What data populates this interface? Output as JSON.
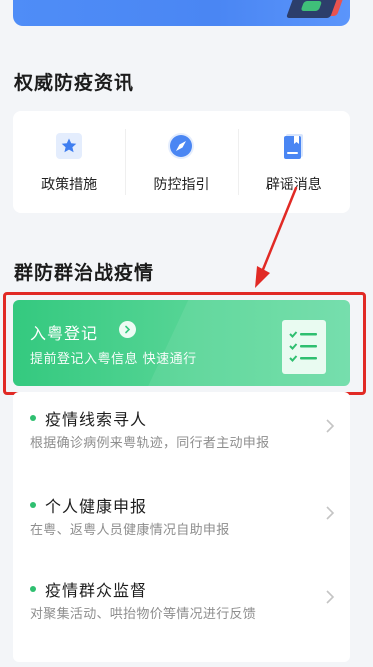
{
  "section_info": {
    "title": "权威防疫资讯",
    "items": [
      {
        "label": "政策措施",
        "icon": "star-icon"
      },
      {
        "label": "防控指引",
        "icon": "compass-icon"
      },
      {
        "label": "辟谣消息",
        "icon": "bookmark-doc-icon"
      }
    ]
  },
  "section_group": {
    "title": "群防群治战疫情",
    "register": {
      "title": "入粤登记",
      "subtitle": "提前登记入粤信息 快速通行"
    },
    "list": [
      {
        "title": "疫情线索寻人",
        "subtitle": "根据确诊病例来粤轨迹，同行者主动申报"
      },
      {
        "title": "个人健康申报",
        "subtitle": "在粤、返粤人员健康情况自助申报"
      },
      {
        "title": "疫情群众监督",
        "subtitle": "对聚集活动、哄抬物价等情况进行反馈"
      }
    ]
  },
  "colors": {
    "accent_blue": "#4a86f3",
    "accent_green": "#34c97f",
    "annotation_red": "#e12a25"
  }
}
